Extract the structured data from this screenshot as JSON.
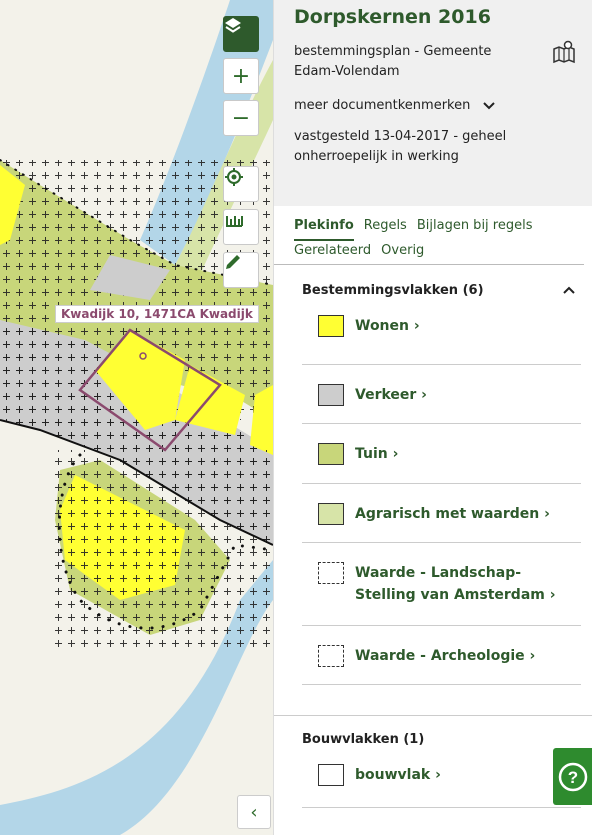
{
  "map": {
    "label": "Kwadijk 10, 1471CA Kwadijk",
    "controls": [
      "layers-icon",
      "zoom-in-icon",
      "zoom-out-icon",
      "locate-icon",
      "measure-icon",
      "draw-icon"
    ],
    "zoom_in": "+",
    "zoom_out": "−",
    "collapse": "‹"
  },
  "panel": {
    "title": "Dorpskernen 2016",
    "subtitle": "bestemmingsplan - Gemeente Edam-Volendam",
    "meer": "meer documentkenmerken",
    "status": "vastgesteld 13-04-2017 - geheel onherroepelijk in werking",
    "tabs": [
      "Plekinfo",
      "Regels",
      "Bijlagen bij regels",
      "Gerelateerd",
      "Overig"
    ],
    "active_tab": "Plekinfo"
  },
  "bestemmingsvlakken": {
    "heading": "Bestemmingsvlakken (6)",
    "items": [
      {
        "label": "Wonen",
        "color": "#ffff33"
      },
      {
        "label": "Verkeer",
        "color": "#cdcdcd"
      },
      {
        "label": "Tuin",
        "color": "#c8d67a"
      },
      {
        "label": "Agrarisch met waarden",
        "color": "#d7e4a8"
      },
      {
        "label": "Waarde - Landschap-Stelling van Amsterdam",
        "color": "#ffffff"
      },
      {
        "label": "Waarde - Archeologie",
        "color": "#ffffff"
      }
    ]
  },
  "bouwvlakken": {
    "heading": "Bouwvlakken (1)",
    "items": [
      {
        "label": "bouwvlak",
        "color": "#ffffff"
      }
    ]
  },
  "colors": {
    "brand": "#2e5a2c",
    "help": "#2e8b2e"
  }
}
